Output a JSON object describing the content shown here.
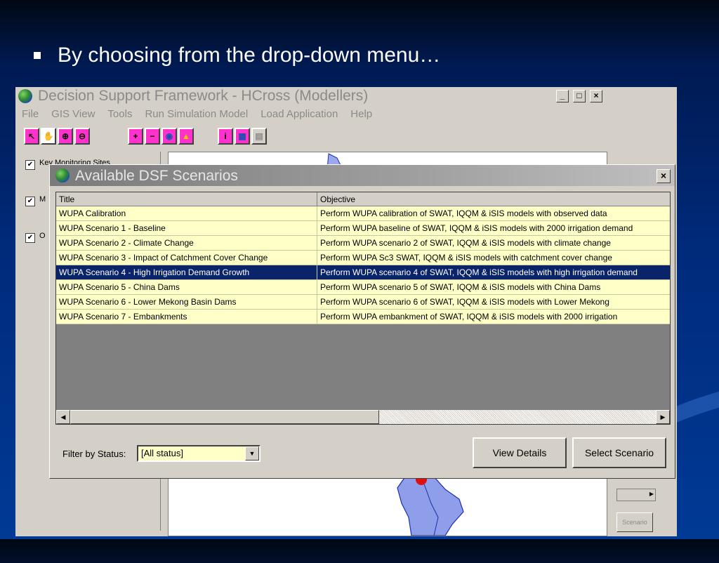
{
  "slide": {
    "bullet_text": "By choosing from the drop-down menu…"
  },
  "main_window": {
    "title": "Decision Support Framework - HCross (Modellers)",
    "controls": {
      "minimize": "_",
      "maximize": "□",
      "close": "×"
    },
    "menu": [
      "File",
      "GIS View",
      "Tools",
      "Run Simulation Model",
      "Load Application",
      "Help"
    ],
    "toolbar_icons": [
      "select-arrow-icon",
      "pan-hand-icon",
      "zoom-in-icon",
      "zoom-out-icon",
      "add-icon",
      "remove-icon",
      "globe-icon",
      "layer-icon",
      "info-icon",
      "identify-icon",
      "grid-icon"
    ],
    "layers": [
      {
        "checked": true,
        "label": "Key Monitoring Sites"
      },
      {
        "checked": true,
        "label": "M"
      },
      {
        "checked": true,
        "label": "O"
      }
    ],
    "behind_button": "Scenario"
  },
  "dialog": {
    "title": "Available DSF Scenarios",
    "close": "×",
    "columns": [
      "Title",
      "Objective"
    ],
    "rows": [
      {
        "title": "WUPA Calibration",
        "objective": "Perform WUPA calibration of SWAT, IQQM & iSIS models with observed data"
      },
      {
        "title": "WUPA Scenario 1 - Baseline",
        "objective": "Perform WUPA baseline of SWAT, IQQM & iSIS models with 2000 irrigation demand"
      },
      {
        "title": "WUPA Scenario 2 - Climate Change",
        "objective": "Perform WUPA scenario 2 of SWAT, IQQM & iSIS models with climate change"
      },
      {
        "title": "WUPA Scenario 3 - Impact of Catchment Cover Change",
        "objective": "Perform WUPA Sc3 SWAT, IQQM & iSIS models with catchment cover change"
      },
      {
        "title": "WUPA Scenario 4 - High Irrigation Demand Growth",
        "objective": "Perform WUPA scenario 4 of SWAT, IQQM & iSIS models with high irrigation demand",
        "selected": true
      },
      {
        "title": "WUPA Scenario 5 - China Dams",
        "objective": "Perform WUPA scenario 5 of SWAT, IQQM & iSIS models with China Dams"
      },
      {
        "title": "WUPA Scenario 6 - Lower Mekong Basin Dams",
        "objective": "Perform WUPA scenario 6 of SWAT, IQQM & iSIS models with Lower Mekong"
      },
      {
        "title": "WUPA Scenario 7 - Embankments",
        "objective": "Perform WUPA embankment of SWAT, IQQM & iSIS models with 2000 irrigation"
      }
    ],
    "filter_label": "Filter by Status:",
    "filter_value": "[All status]",
    "view_details": "View Details",
    "select_scenario": "Select Scenario"
  },
  "colors": {
    "row_bg": "#ffffc8",
    "selected_bg": "#0a246a",
    "window_bg": "#d4d0c8"
  }
}
